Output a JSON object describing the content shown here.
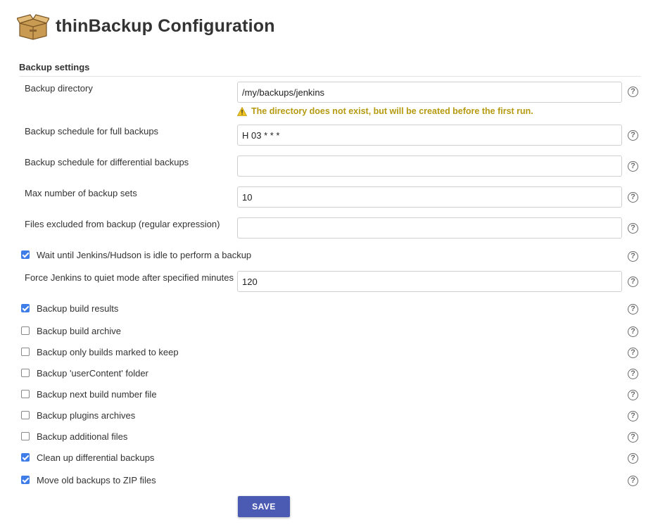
{
  "header": {
    "title": "thinBackup Configuration",
    "logo_icon": "backup-box-icon"
  },
  "section": {
    "title": "Backup settings"
  },
  "fields": {
    "backup_directory": {
      "label": "Backup directory",
      "value": "/my/backups/jenkins"
    },
    "warning": {
      "text": "The directory does not exist, but will be created before the first run.",
      "color": "#b59a10"
    },
    "full_schedule": {
      "label": "Backup schedule for full backups",
      "value": "H 03 * * *"
    },
    "diff_schedule": {
      "label": "Backup schedule for differential backups",
      "value": ""
    },
    "max_sets": {
      "label": "Max number of backup sets",
      "value": "10"
    },
    "excluded": {
      "label": "Files excluded from backup (regular expression)",
      "value": ""
    },
    "quiet_minutes": {
      "label": "Force Jenkins to quiet mode after specified minutes",
      "value": "120"
    }
  },
  "checkboxes": [
    {
      "label": "Wait until Jenkins/Hudson is idle to perform a backup",
      "checked": true
    },
    {
      "label": "Backup build results",
      "checked": true
    },
    {
      "label": "Backup build archive",
      "checked": false
    },
    {
      "label": "Backup only builds marked to keep",
      "checked": false
    },
    {
      "label": "Backup 'userContent' folder",
      "checked": false
    },
    {
      "label": "Backup next build number file",
      "checked": false
    },
    {
      "label": "Backup plugins archives",
      "checked": false
    },
    {
      "label": "Backup additional files",
      "checked": false
    },
    {
      "label": "Clean up differential backups",
      "checked": true
    },
    {
      "label": "Move old backups to ZIP files",
      "checked": true
    }
  ],
  "help_glyph": "?",
  "save_button": {
    "label": "SAVE",
    "color": "#4b5ab3"
  }
}
